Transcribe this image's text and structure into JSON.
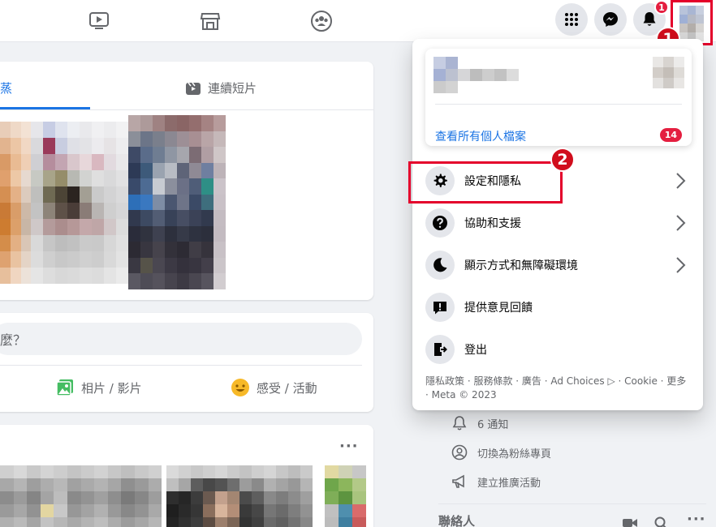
{
  "topbar": {
    "nav_icons": [
      "video-icon",
      "marketplace-icon",
      "groups-icon"
    ],
    "menu_icon": "apps-grid-icon",
    "messenger_icon": "messenger-icon",
    "notification_icon": "bell-icon",
    "notification_count": "1"
  },
  "annotations": {
    "step1": "1",
    "step2": "2"
  },
  "feed": {
    "stories_tab_partial": "蒸",
    "reels_tab": "連續短片",
    "composer_placeholder_partial": "麼？",
    "photo_video_label": "相片 / 影片",
    "feeling_label": "感受 / 活動",
    "more_label": "···"
  },
  "account_menu": {
    "see_all_profiles": "查看所有個人檔案",
    "profiles_badge": "14",
    "items": [
      {
        "label": "設定和隱私",
        "icon": "gear-icon",
        "chevron": true
      },
      {
        "label": "協助和支援",
        "icon": "question-icon",
        "chevron": true
      },
      {
        "label": "顯示方式和無障礙環境",
        "icon": "moon-icon",
        "chevron": true
      },
      {
        "label": "提供意見回饋",
        "icon": "feedback-icon",
        "chevron": false
      },
      {
        "label": "登出",
        "icon": "logout-icon",
        "chevron": false
      }
    ],
    "footer_line1": "隱私政策 · 服務條款 · 廣告 · Ad Choices ▷ · Cookie · 更多",
    "footer_line2": "· Meta © 2023"
  },
  "sidebar": {
    "items": [
      {
        "label": "6 通知",
        "icon": "bell-outline-icon"
      },
      {
        "label": "切換為粉絲專頁",
        "icon": "switch-profile-icon"
      },
      {
        "label": "建立推廣活動",
        "icon": "megaphone-icon"
      }
    ],
    "contacts_title": "聯絡人"
  },
  "colors": {
    "accent": "#1b74e4",
    "highlight": "#e4002b",
    "badge": "#e41e3f"
  }
}
